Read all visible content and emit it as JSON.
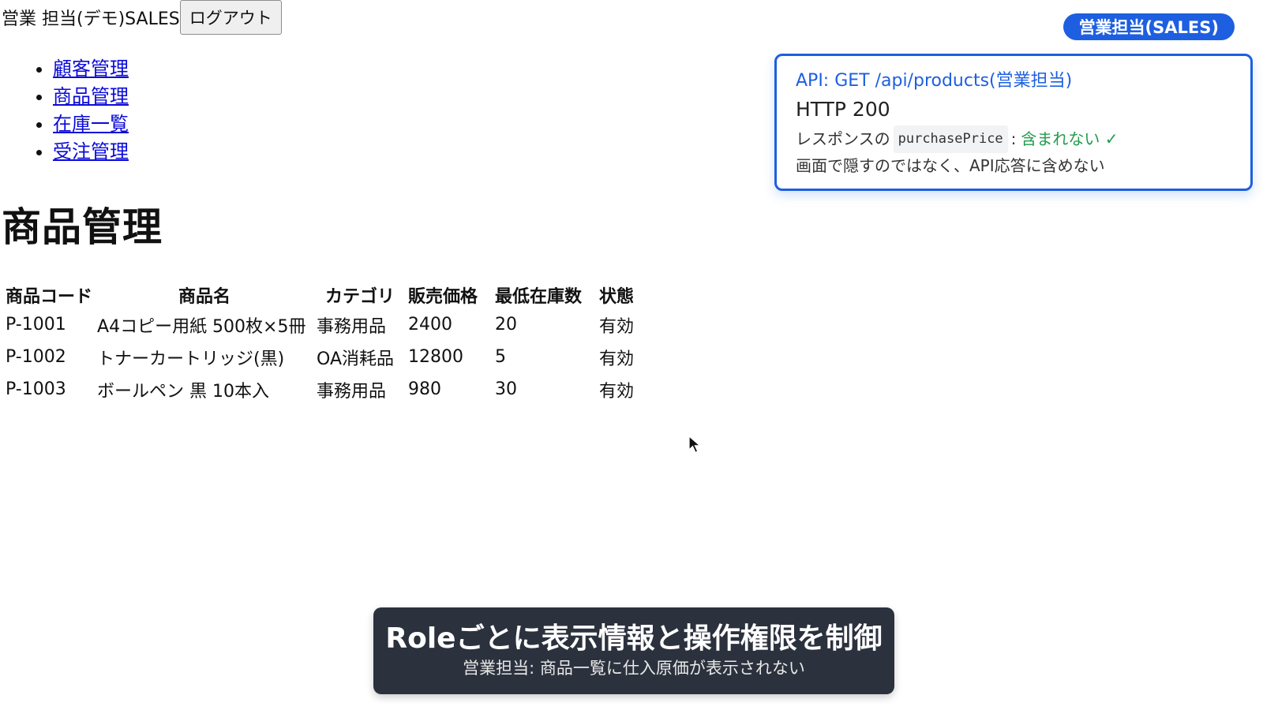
{
  "header": {
    "user_label": "営業 担当(デモ)SALES",
    "logout_label": "ログアウト"
  },
  "nav": {
    "items": [
      {
        "label": "顧客管理"
      },
      {
        "label": "商品管理"
      },
      {
        "label": "在庫一覧"
      },
      {
        "label": "受注管理"
      }
    ]
  },
  "main": {
    "title": "商品管理",
    "table": {
      "headers": [
        "商品コード",
        "商品名",
        "カテゴリ",
        "販売価格",
        "最低在庫数",
        "状態"
      ],
      "rows": [
        [
          "P-1001",
          "A4コピー用紙 500枚×5冊",
          "事務用品",
          "2400",
          "20",
          "有効"
        ],
        [
          "P-1002",
          "トナーカートリッジ(黒)",
          "OA消耗品",
          "12800",
          "5",
          "有効"
        ],
        [
          "P-1003",
          "ボールペン 黒 10本入",
          "事務用品",
          "980",
          "30",
          "有効"
        ]
      ]
    }
  },
  "role_badge": "営業担当(SALES)",
  "api_card": {
    "title": "API: GET /api/products(営業担当)",
    "status": "HTTP 200",
    "resp_prefix": "レスポンスの",
    "resp_field": "purchasePrice",
    "resp_colon": ":",
    "resp_result": "含まれない ✓",
    "note": "画面で隠すのではなく、API応答に含めない"
  },
  "caption": {
    "title": "Roleごとに表示情報と操作権限を制御",
    "subtitle": "営業担当: 商品一覧に仕入原価が表示されない"
  },
  "colors": {
    "accent": "#1d5fe0",
    "success": "#1f9d4b",
    "caption_bg": "#2b313d",
    "link": "#0a0ad8"
  },
  "icons": {
    "cursor": "mouse-pointer-icon",
    "check": "checkmark-icon"
  }
}
